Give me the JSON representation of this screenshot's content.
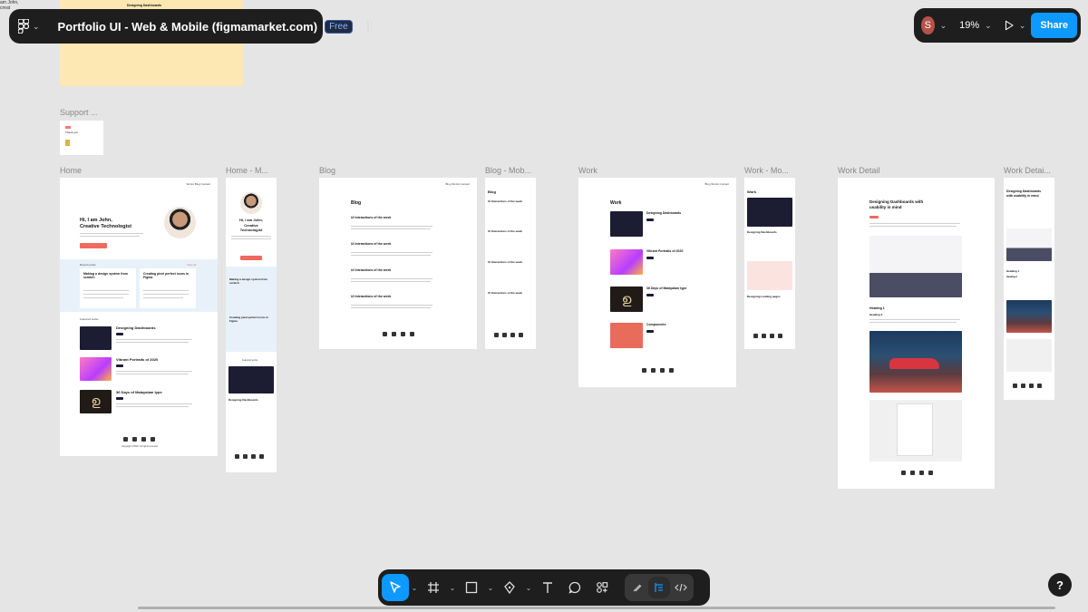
{
  "app": {
    "file_title": "Portfolio UI - Web & Mobile (figmamarket.com)",
    "plan_badge": "Free",
    "user_initial": "S",
    "zoom_level": "19%",
    "share_label": "Share",
    "help_label": "?",
    "accent_color": "#0d99ff"
  },
  "canvas": {
    "left_strip_text": "am John,\ncreat",
    "sticky_label": "Designing Dashboards",
    "support_label": "Support ...",
    "support_text": "Thank you",
    "frame_labels": {
      "home": "Home",
      "home_mobile": "Home - M...",
      "blog": "Blog",
      "blog_mobile": "Blog - Mob...",
      "work": "Work",
      "work_mobile": "Work - Mo...",
      "work_detail": "Work Detail",
      "work_detail_mobile": "Work Detai..."
    },
    "home": {
      "nav": "Works   Blog   Contact",
      "hero": "Hi, I am John,\nCreative Technologist",
      "recent_posts": "Recent posts",
      "view_all": "View all",
      "post1": "Making a design system from scratch",
      "post2": "Creating pixel perfect icons in Figma",
      "featured": "Featured works",
      "work1": "Designing Dashboards",
      "work2": "Vibrant Portraits of 2020",
      "work3": "36 Days of Malayalam type",
      "copyright": "Copyright ©2020. All rights reserved"
    },
    "home_mobile": {
      "hero": "Hi, I am John,\nCreative\nTechnologist",
      "post1": "Making a design system from scratch",
      "post2": "Creating pixel perfect icons in Figma",
      "featured": "Featured works",
      "work1": "Designing Dashboards"
    },
    "blog": {
      "nav": "Blog   Works   Contact",
      "title": "Blog",
      "post": "UI Interactions of the week"
    },
    "blog_mobile": {
      "title": "Blog",
      "post": "UI Interactions of the week"
    },
    "work": {
      "nav": "Blog   Works   Contact",
      "title": "Work",
      "item1": "Designing Dashboards",
      "item2": "Vibrant Portraits of 2020",
      "item3": "36 Days of Malayalam type",
      "item4": "Components"
    },
    "work_mobile": {
      "title": "Work",
      "item1": "Designing Dashboards",
      "item2": "Designing Landing pages"
    },
    "work_detail": {
      "title": "Designing Dashboards with\nusability in mind",
      "heading1": "Heading 1",
      "heading2": "Heading 2"
    },
    "work_detail_mobile": {
      "title": "Designing Dashboards\nwith usability in mind",
      "heading1": "Heading 1",
      "heading2": "Heading 2"
    }
  },
  "toolbar": {
    "tools": [
      "move-tool",
      "frame-tool",
      "shape-tool",
      "pen-tool",
      "text-tool",
      "comment-tool",
      "actions-tool"
    ],
    "dev_tools": [
      "draw-tool",
      "design-tool",
      "dev-mode-tool"
    ]
  }
}
